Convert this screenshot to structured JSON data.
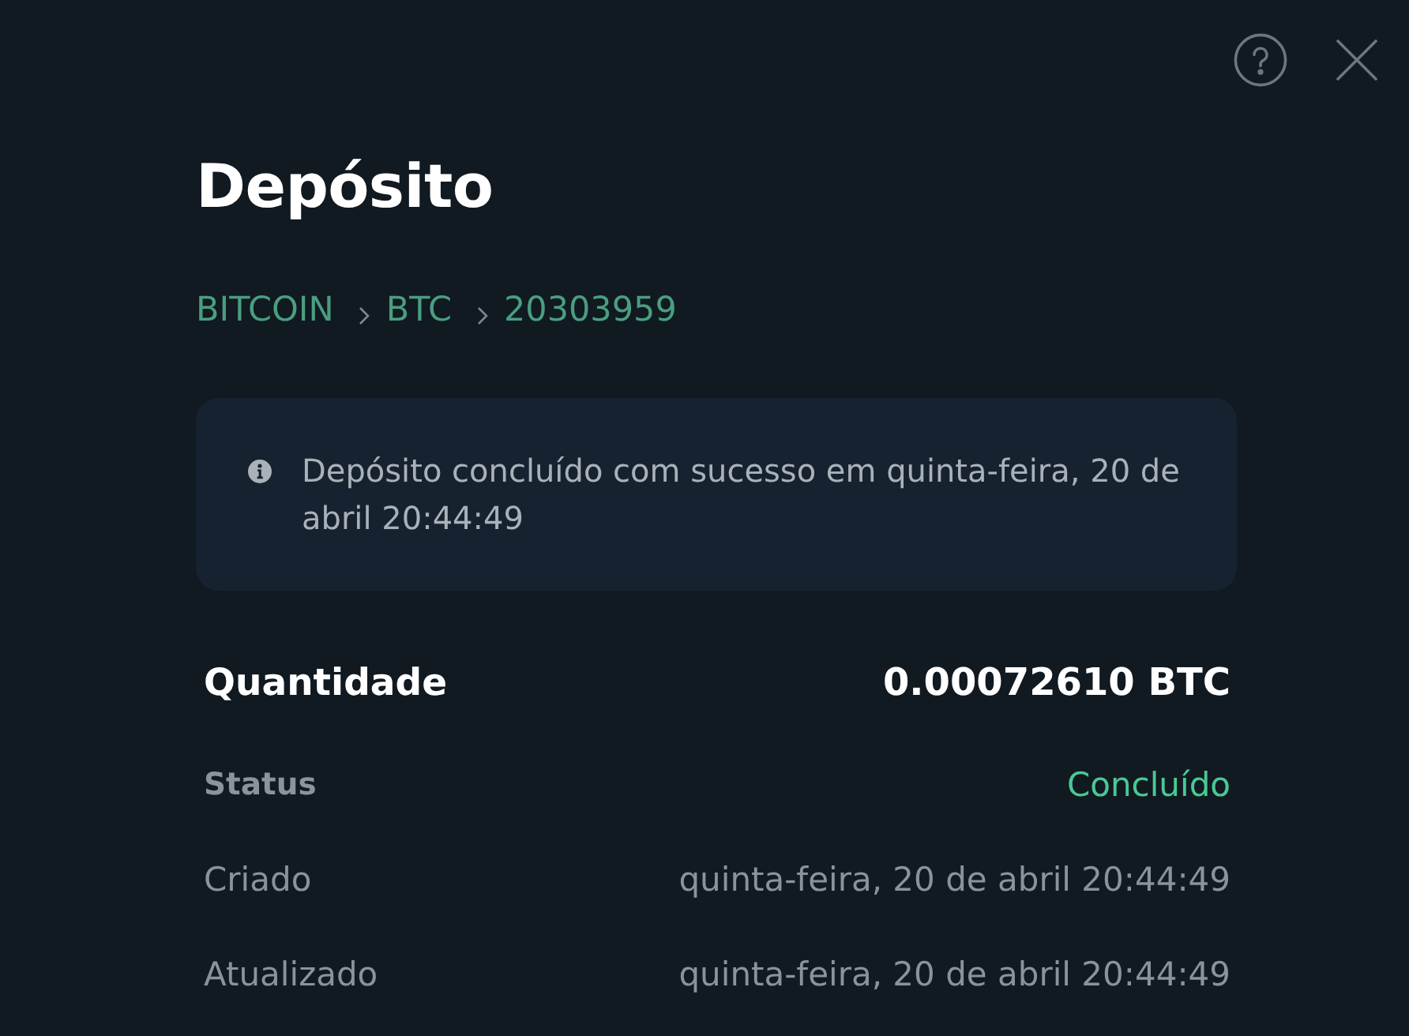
{
  "title": "Depósito",
  "breadcrumb": [
    "BITCOIN",
    "BTC",
    "20303959"
  ],
  "notice": {
    "text": "Depósito concluído com sucesso em quinta-feira, 20 de abril 20:44:49"
  },
  "details": [
    {
      "kind": "amount",
      "label": "Quantidade",
      "value": "0.00072610 BTC"
    },
    {
      "kind": "status",
      "label": "Status",
      "value": "Concluído"
    },
    {
      "kind": "plain",
      "label": "Criado",
      "value": "quinta-feira, 20 de abril 20:44:49"
    },
    {
      "kind": "plain",
      "label": "Atualizado",
      "value": "quinta-feira, 20 de abril 20:44:49"
    }
  ]
}
